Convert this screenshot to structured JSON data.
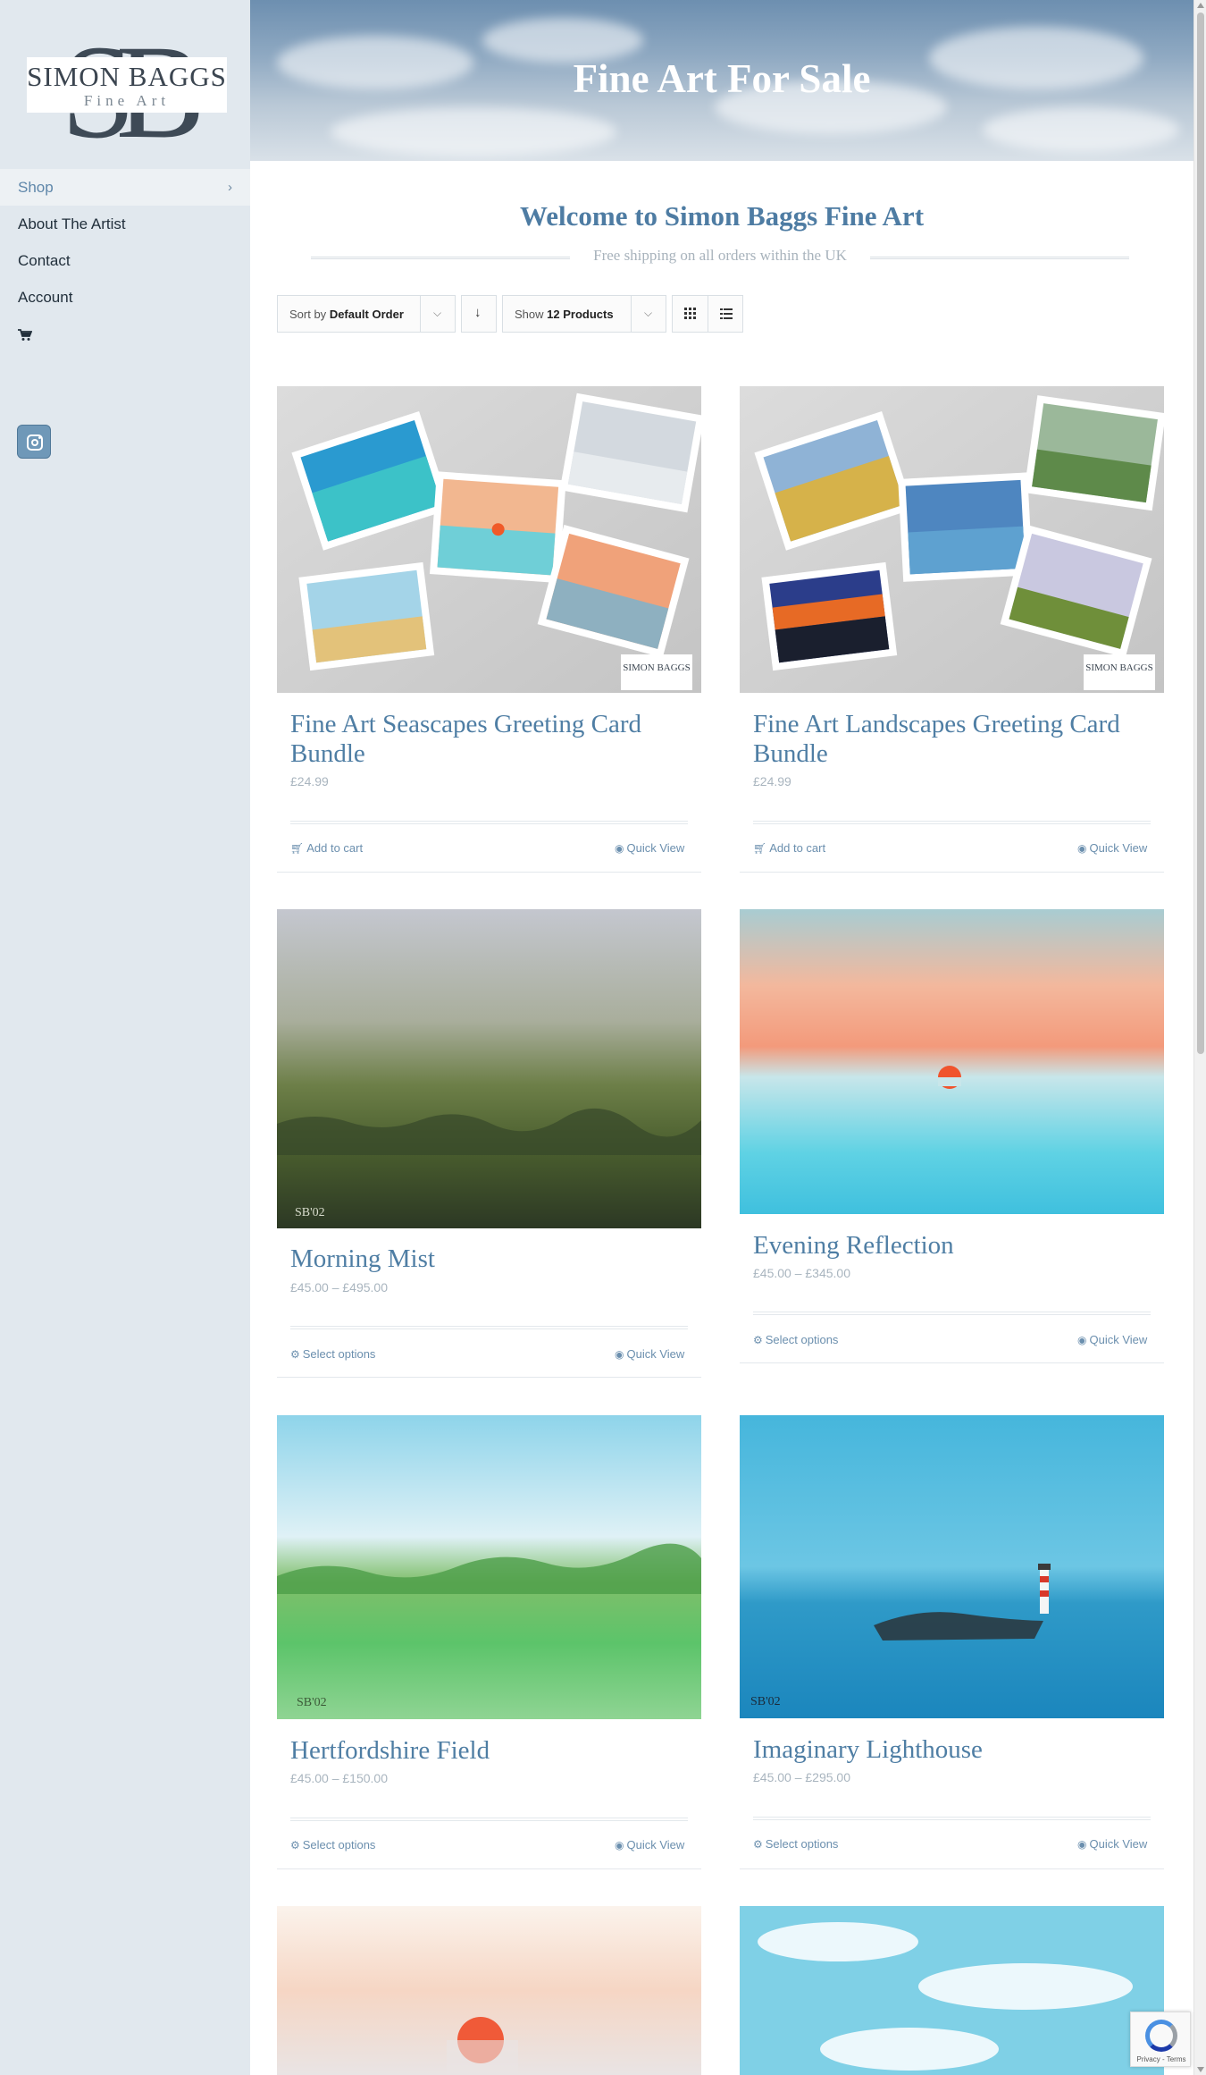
{
  "site": {
    "logo_monogram": "SB",
    "logo_name": "SIMON BAGGS",
    "logo_sub": "Fine Art"
  },
  "nav": {
    "items": [
      {
        "label": "Shop",
        "active": true
      },
      {
        "label": "About The Artist"
      },
      {
        "label": "Contact"
      },
      {
        "label": "Account"
      }
    ],
    "cart_icon": "cart-icon",
    "social_icon": "instagram-icon"
  },
  "header": {
    "title": "Fine Art For Sale"
  },
  "intro": {
    "heading": "Welcome to Simon Baggs Fine Art",
    "shipping": "Free shipping on all orders within the UK"
  },
  "toolbar": {
    "sort_prefix": "Sort by",
    "sort_value": "Default Order",
    "show_prefix": "Show",
    "show_value": "12 Products"
  },
  "products": [
    {
      "title_1": "Fine Art Seascapes Greeting Card",
      "title_2": "Bundle",
      "price": "£24.99",
      "action": "Add to cart",
      "quick": "Quick View"
    },
    {
      "title_1": "Fine Art Landscapes Greeting Card",
      "title_2": "Bundle",
      "price": "£24.99",
      "action": "Add to cart",
      "quick": "Quick View"
    },
    {
      "title": "Morning Mist",
      "price": "£45.00 – £495.00",
      "action": "Select options",
      "quick": "Quick View"
    },
    {
      "title": "Evening Reflection",
      "price": "£45.00 – £345.00",
      "action": "Select options",
      "quick": "Quick View"
    },
    {
      "title": "Hertfordshire Field",
      "price": "£45.00 – £150.00",
      "action": "Select options",
      "quick": "Quick View"
    },
    {
      "title": "Imaginary Lighthouse",
      "price": "£45.00 – £295.00",
      "action": "Select options",
      "quick": "Quick View"
    }
  ],
  "artwork": {
    "monogram": "SIMON BAGGS",
    "signature": "SB'02"
  },
  "recaptcha": {
    "label": "Privacy - Terms"
  },
  "colors": {
    "sidebar_bg": "#e1e8ee",
    "accent": "#4f7ea4",
    "price": "#a9b5bf"
  }
}
